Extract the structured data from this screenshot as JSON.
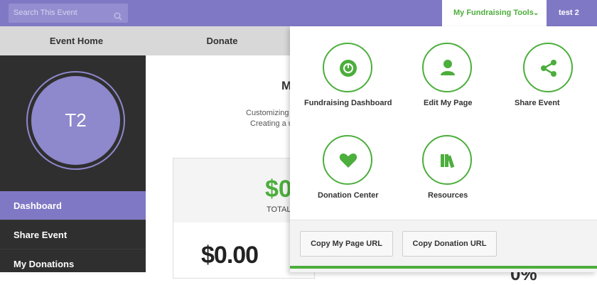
{
  "search": {
    "placeholder": "Search This Event",
    "icon": "search-icon"
  },
  "header": {
    "tools_label": "My Fundraising Tools",
    "user_label": "test 2"
  },
  "nav": {
    "tabs": [
      {
        "label": "Event Home"
      },
      {
        "label": "Donate"
      }
    ]
  },
  "sidebar": {
    "avatar_initials": "T2",
    "items": [
      {
        "label": "Dashboard",
        "active": true
      },
      {
        "label": "Share Event"
      },
      {
        "label": "My Donations"
      }
    ]
  },
  "main": {
    "title_fragment": "M",
    "text1": "Customizing",
    "text2": "Creating a u",
    "card_value": "$0",
    "card_label": "TOTAL",
    "big_amount": "$0.00",
    "right_fragment": "0%"
  },
  "tools": {
    "items": [
      {
        "label": "Fundraising Dashboard",
        "icon": "gauge-icon"
      },
      {
        "label": "Edit My Page",
        "icon": "person-icon"
      },
      {
        "label": "Share Event",
        "icon": "share-icon"
      },
      {
        "label": "Donation Center",
        "icon": "heart-icon"
      },
      {
        "label": "Resources",
        "icon": "books-icon"
      }
    ],
    "copy_page_url": "Copy My Page URL",
    "copy_donation_url": "Copy Donation URL"
  },
  "colors": {
    "brand_purple": "#7f78c4",
    "accent_green": "#4cae3c",
    "sidebar_dark": "#2f2f2f"
  }
}
